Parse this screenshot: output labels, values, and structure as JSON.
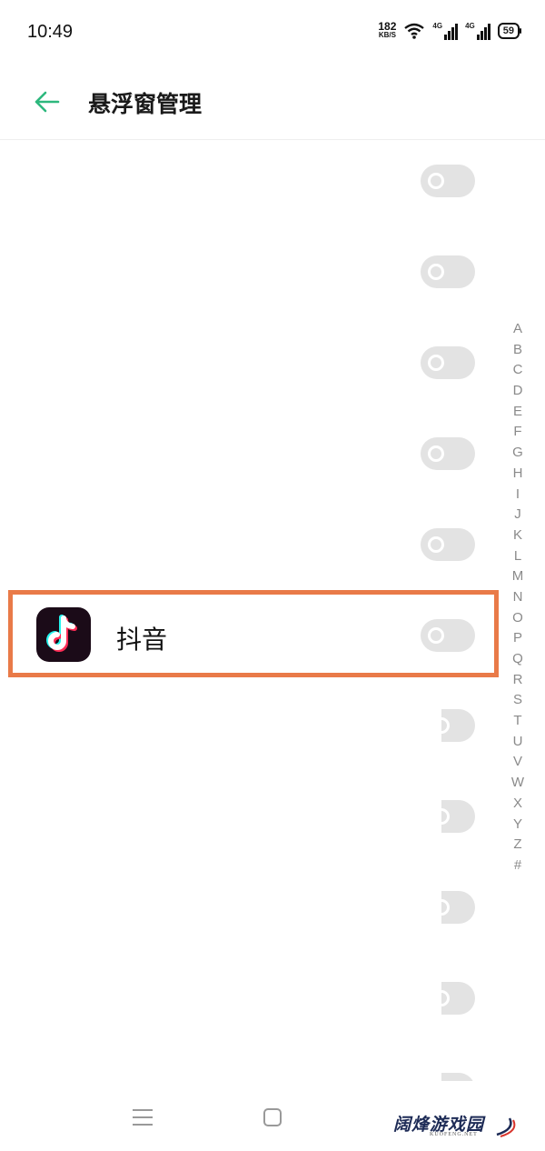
{
  "status_bar": {
    "time": "10:49",
    "net_speed_value": "182",
    "net_speed_unit": "KB/S",
    "signal_1_tag": "4G",
    "signal_2_tag": "4G",
    "battery": "59",
    "icons": [
      "wifi-icon",
      "signal-icon",
      "signal-icon",
      "battery-icon"
    ]
  },
  "header": {
    "back_icon": "arrow-left-icon",
    "title": "悬浮窗管理",
    "accent_color": "#2db87d"
  },
  "app_list": {
    "highlighted_app": {
      "name": "抖音",
      "icon": "tiktok-icon",
      "toggle_on": false
    },
    "toggle_count": 11
  },
  "alphabet_index": [
    "A",
    "B",
    "C",
    "D",
    "E",
    "F",
    "G",
    "H",
    "I",
    "J",
    "K",
    "L",
    "M",
    "N",
    "O",
    "P",
    "Q",
    "R",
    "S",
    "T",
    "U",
    "V",
    "W",
    "X",
    "Y",
    "Z",
    "#"
  ],
  "annotation": {
    "highlight_color": "#e97a48"
  },
  "nav_bar": {
    "icons": [
      "menu-icon",
      "home-icon"
    ]
  },
  "watermark": {
    "text": "阔烽游戏园",
    "sub": "KUOFENG.NET"
  }
}
